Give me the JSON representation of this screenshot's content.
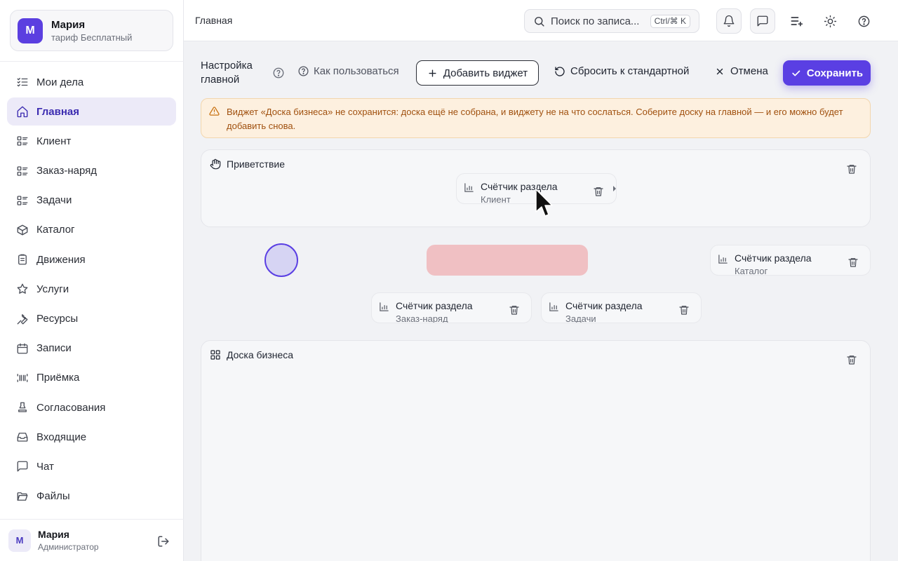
{
  "account": {
    "initial": "М",
    "name": "Мария",
    "plan": "тариф Бесплатный"
  },
  "sidebar": {
    "items": [
      {
        "label": "Мои дела",
        "icon": "checklist-icon",
        "active": false
      },
      {
        "label": "Главная",
        "icon": "home-icon",
        "active": true
      },
      {
        "label": "Клиент",
        "icon": "list-icon",
        "active": false
      },
      {
        "label": "Заказ-наряд",
        "icon": "list-icon",
        "active": false
      },
      {
        "label": "Задачи",
        "icon": "list-icon",
        "active": false
      },
      {
        "label": "Каталог",
        "icon": "box-icon",
        "active": false
      },
      {
        "label": "Движения",
        "icon": "clipboard-icon",
        "active": false
      },
      {
        "label": "Услуги",
        "icon": "star-icon",
        "active": false
      },
      {
        "label": "Ресурсы",
        "icon": "wrench-icon",
        "active": false
      },
      {
        "label": "Записи",
        "icon": "calendar-icon",
        "active": false
      },
      {
        "label": "Приёмка",
        "icon": "barcode-icon",
        "active": false
      },
      {
        "label": "Согласования",
        "icon": "stamp-icon",
        "active": false
      },
      {
        "label": "Входящие",
        "icon": "inbox-icon",
        "active": false
      },
      {
        "label": "Чат",
        "icon": "chat-icon",
        "active": false
      },
      {
        "label": "Файлы",
        "icon": "folder-icon",
        "active": false
      }
    ],
    "footer": {
      "initial": "М",
      "name": "Мария",
      "role": "Администратор"
    }
  },
  "topbar": {
    "breadcrumb": "Главная",
    "search_text": "Поиск по записа...",
    "search_shortcut": "Ctrl/⌘ K"
  },
  "editor": {
    "title_line1": "Настройка",
    "title_line2": "главной",
    "howto_label": "Как пользоваться",
    "add_widget_label": "Добавить виджет",
    "reset_label": "Сбросить к стандартной",
    "cancel_label": "Отмена",
    "save_label": "Сохранить"
  },
  "warning": {
    "text": "Виджет «Доска бизнеса» не сохранится: доска ещё не собрана, и виджету не на что сослаться. Соберите доску на главной — и его можно будет добавить снова."
  },
  "widgets": {
    "greeting": {
      "title": "Приветствие"
    },
    "business_board": {
      "title": "Доска бизнеса"
    },
    "counters": [
      {
        "title": "Счётчик раздела",
        "sub": "Клиент"
      },
      {
        "title": "Счётчик раздела",
        "sub": "Каталог"
      },
      {
        "title": "Счётчик раздела",
        "sub": "Заказ-наряд"
      },
      {
        "title": "Счётчик раздела",
        "sub": "Задачи"
      }
    ]
  },
  "colors": {
    "accent": "#5a3fe3",
    "warning_bg": "#fdf0df",
    "warning_text": "#a0500e",
    "drop_zone": "#f0c0c3"
  }
}
